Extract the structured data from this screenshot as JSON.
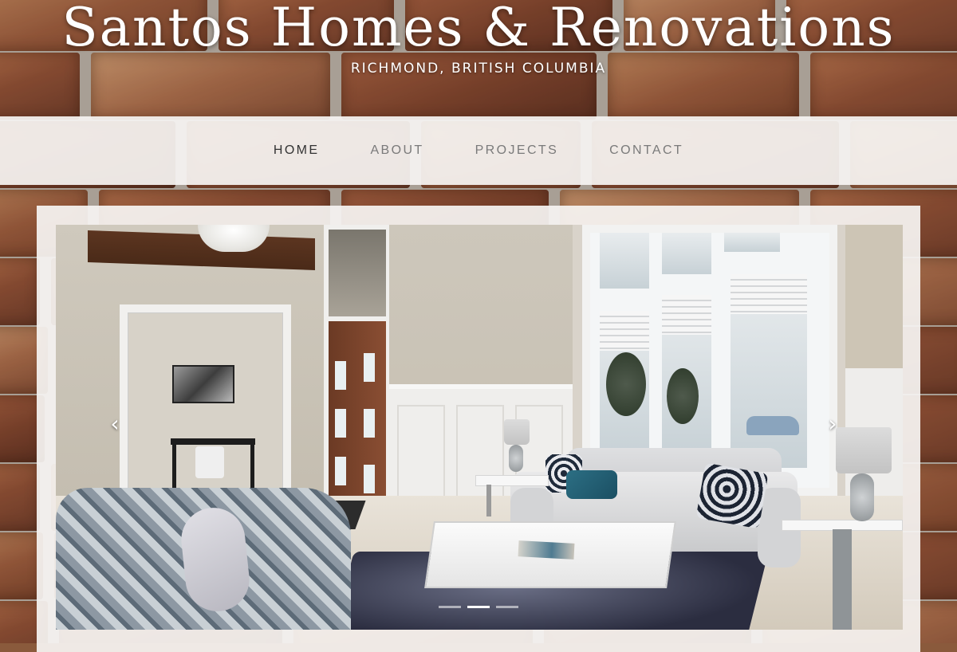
{
  "header": {
    "title": "Santos Homes & Renovations",
    "subtitle": "RICHMOND, BRITISH COLUMBIA"
  },
  "nav": {
    "items": [
      {
        "label": "HOME",
        "active": true
      },
      {
        "label": "ABOUT",
        "active": false
      },
      {
        "label": "PROJECTS",
        "active": false
      },
      {
        "label": "CONTACT",
        "active": false
      }
    ]
  },
  "slider": {
    "prev_icon": "chevron-left-icon",
    "next_icon": "chevron-right-icon",
    "prev_glyph": "‹",
    "next_glyph": "›",
    "slide_count": 3,
    "active_slide": 2
  },
  "colors": {
    "nav_background": "#f6f4f2",
    "nav_active_text": "#333333",
    "nav_text": "#7a7a7a",
    "title_text": "#ffffff"
  }
}
